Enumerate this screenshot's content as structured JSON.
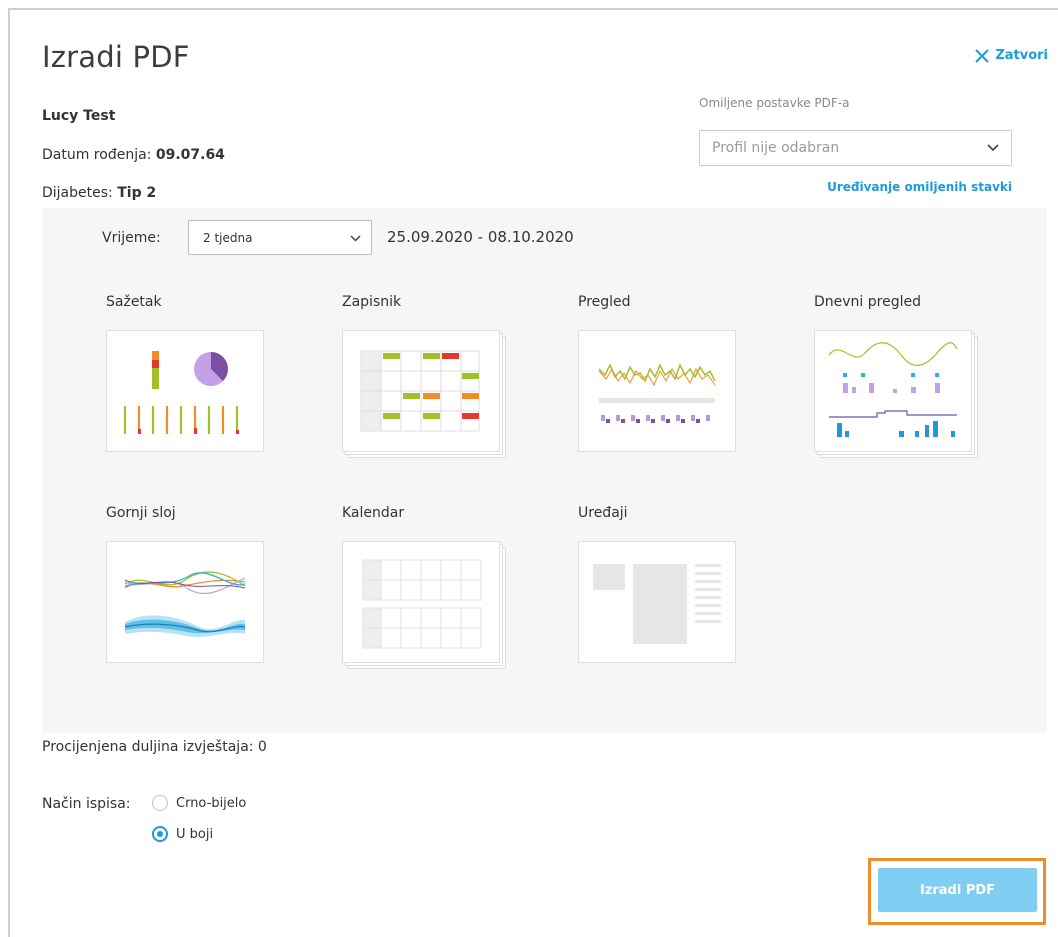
{
  "dialog": {
    "title": "Izradi PDF",
    "close_label": "Zatvori"
  },
  "patient": {
    "name": "Lucy Test",
    "dob_label": "Datum rođenja:",
    "dob_value": "09.07.64",
    "diabetes_label": "Dijabetes:",
    "diabetes_value": "Tip 2"
  },
  "preferences": {
    "label": "Omiljene postavke PDF-a",
    "selected": "Profil nije odabran",
    "edit_link": "Uređivanje omiljenih stavki"
  },
  "time": {
    "label": "Vrijeme:",
    "selected": "2 tjedna",
    "range": "25.09.2020 - 08.10.2020"
  },
  "reports": [
    {
      "label": "Sažetak",
      "icon": "summary-thumbnail"
    },
    {
      "label": "Zapisnik",
      "icon": "logbook-thumbnail"
    },
    {
      "label": "Pregled",
      "icon": "overview-thumbnail"
    },
    {
      "label": "Dnevni pregled",
      "icon": "daily-overview-thumbnail"
    },
    {
      "label": "Gornji sloj",
      "icon": "overlay-thumbnail"
    },
    {
      "label": "Kalendar",
      "icon": "calendar-thumbnail"
    },
    {
      "label": "Uređaji",
      "icon": "devices-thumbnail"
    }
  ],
  "estimate": {
    "label": "Procijenjena duljina izvještaja: 0"
  },
  "print_mode": {
    "label": "Način ispisa:",
    "options": [
      "Crno-bijelo",
      "U boji"
    ],
    "selected": "U boji"
  },
  "actions": {
    "create_label": "Izradi PDF"
  },
  "colors": {
    "accent": "#1e9bd7",
    "button": "#7fcdf0",
    "highlight": "#f28c28",
    "panel": "#f6f6f6"
  }
}
